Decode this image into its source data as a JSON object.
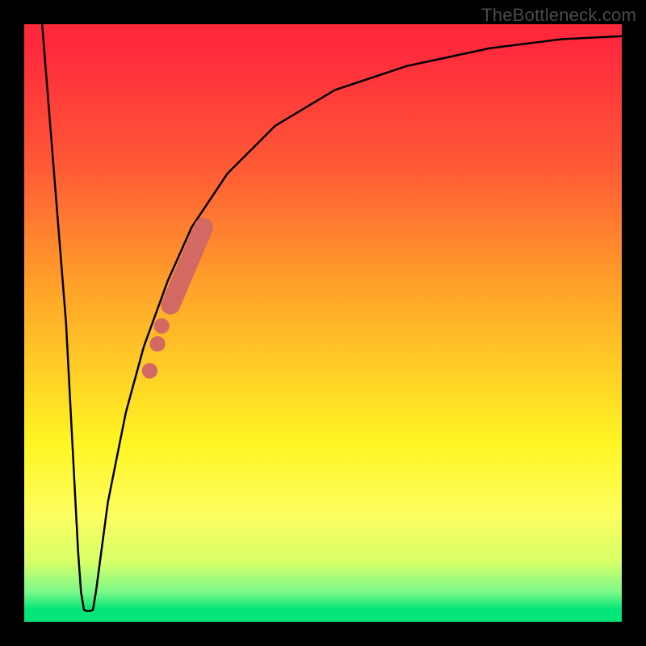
{
  "watermark": "TheBottleneck.com",
  "colors": {
    "frame": "#000000",
    "watermark": "#4a4a4a",
    "curve_stroke": "#000000",
    "marker_fill": "#d26a63",
    "gradient_top": "#fe2a3c",
    "gradient_bottom": "#02e578"
  },
  "chart_data": {
    "type": "line",
    "title": "",
    "xlabel": "",
    "ylabel": "",
    "xlim": [
      0,
      100
    ],
    "ylim": [
      0,
      100
    ],
    "curve": [
      {
        "x": 3.0,
        "y": 100.0
      },
      {
        "x": 7.0,
        "y": 50.0
      },
      {
        "x": 9.0,
        "y": 12.0
      },
      {
        "x": 9.5,
        "y": 5.0
      },
      {
        "x": 10.0,
        "y": 2.0
      },
      {
        "x": 10.5,
        "y": 1.8
      },
      {
        "x": 11.0,
        "y": 1.8
      },
      {
        "x": 11.5,
        "y": 2.0
      },
      {
        "x": 12.0,
        "y": 5.0
      },
      {
        "x": 14.0,
        "y": 20.0
      },
      {
        "x": 17.0,
        "y": 35.0
      },
      {
        "x": 20.0,
        "y": 46.0
      },
      {
        "x": 24.0,
        "y": 57.0
      },
      {
        "x": 28.0,
        "y": 66.0
      },
      {
        "x": 34.0,
        "y": 75.0
      },
      {
        "x": 42.0,
        "y": 83.0
      },
      {
        "x": 52.0,
        "y": 89.0
      },
      {
        "x": 64.0,
        "y": 93.0
      },
      {
        "x": 78.0,
        "y": 96.0
      },
      {
        "x": 90.0,
        "y": 97.5
      },
      {
        "x": 100.0,
        "y": 98.0
      }
    ],
    "markers_round": [
      {
        "x": 21.0,
        "y": 42.0,
        "r": 1.3
      },
      {
        "x": 22.3,
        "y": 46.5,
        "r": 1.3
      },
      {
        "x": 23.0,
        "y": 49.5,
        "r": 1.3
      }
    ],
    "markers_thick_segment": {
      "start": {
        "x": 24.5,
        "y": 53.0
      },
      "end": {
        "x": 30.0,
        "y": 66.0
      },
      "width": 3.2
    }
  }
}
